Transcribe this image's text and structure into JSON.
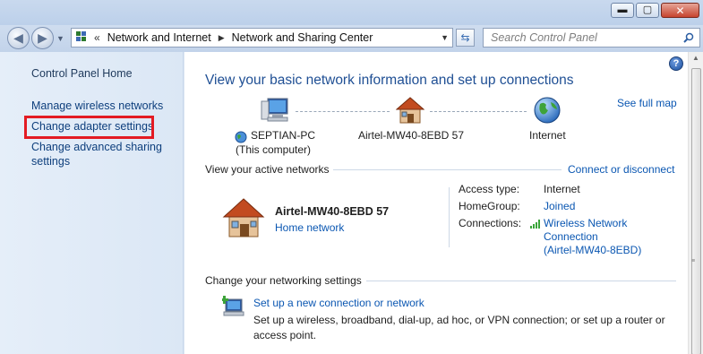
{
  "window": {
    "minimize_glyph": "▬",
    "maximize_glyph": "▢",
    "close_glyph": "✕"
  },
  "address": {
    "prefix": "«",
    "segments": [
      "Network and Internet",
      "Network and Sharing Center"
    ],
    "separator": "▶",
    "dropdown": "▼"
  },
  "search": {
    "placeholder": "Search Control Panel"
  },
  "sidebar": {
    "home": "Control Panel Home",
    "items": [
      {
        "label": "Manage wireless networks"
      },
      {
        "label": "Change adapter settings"
      },
      {
        "label": "Change advanced sharing"
      },
      {
        "label": "settings"
      }
    ]
  },
  "main": {
    "title": "View your basic network information and set up connections",
    "see_full_map": "See full map",
    "map": {
      "computer_name": "SEPTIAN-PC",
      "computer_sub": "(This computer)",
      "network": "Airtel-MW40-8EBD  57",
      "internet": "Internet"
    },
    "active_networks": {
      "header": "View your active networks",
      "connect_link": "Connect or disconnect",
      "network_name": "Airtel-MW40-8EBD  57",
      "network_type": "Home network",
      "access_type_label": "Access type:",
      "access_type_value": "Internet",
      "homegroup_label": "HomeGroup:",
      "homegroup_value": "Joined",
      "connections_label": "Connections:",
      "connection_lines": [
        "Wireless Network",
        "Connection",
        "(Airtel-MW40-8EBD)"
      ]
    },
    "change_settings": {
      "header": "Change your networking settings",
      "setup_link": "Set up a new connection or network",
      "setup_desc_1": "Set up a wireless, broadband, dial-up, ad hoc, or VPN connection; or set up a router or",
      "setup_desc_2": "access point."
    }
  },
  "colors": {
    "link": "#0b57b2",
    "title": "#1f4f94",
    "highlight": "#e31b23",
    "sidebar_link": "#0e3f7d"
  }
}
